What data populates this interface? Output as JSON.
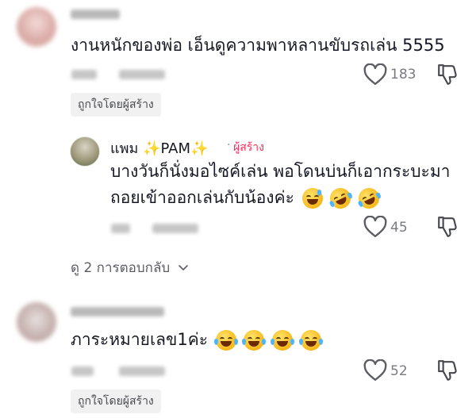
{
  "comments": [
    {
      "text": "งานหนักของพ่อ เอ็นดูความพาหลานขับรถเล่น 5555",
      "likes": "183",
      "badge": "ถูกใจโดยผู้สร้าง",
      "icons": [
        "heart-outline-icon",
        "dislike-icon"
      ]
    },
    {
      "text": "ภาระหมายเลข1ค่ะ",
      "likes": "52",
      "badge": "ถูกใจโดยผู้สร้าง",
      "emoji": [
        "face-with-tears-of-joy",
        "face-with-tears-of-joy",
        "face-with-tears-of-joy",
        "face-with-tears-of-joy"
      ],
      "icons": [
        "heart-outline-icon",
        "dislike-icon"
      ]
    }
  ],
  "reply": {
    "name": "แพม ✨PAM✨",
    "separator": "·",
    "creator_label": "ผู้สร้าง",
    "line1": "บางวันก็นั่งมอไซค์เล่น พอโดนบ่นก็เอากระบะมา",
    "line2": "ถอยเข้าออกเล่นกับน้องค่ะ",
    "emoji": [
      "grinning-face-with-sweat",
      "rolling-on-the-floor-laughing",
      "rolling-on-the-floor-laughing"
    ],
    "likes": "45"
  },
  "view_replies": "ดู 2 การตอบกลับ",
  "colors": {
    "creator_red": "#fe2c55",
    "text": "#161823",
    "muted": "#7a7b80",
    "badge_bg": "#f1f1f2"
  }
}
